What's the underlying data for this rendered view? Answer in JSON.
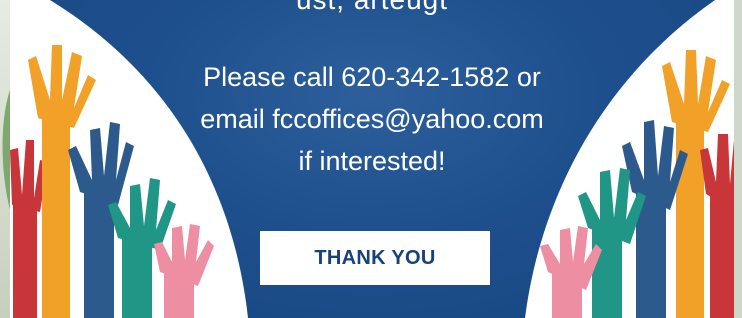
{
  "banner": {
    "cut_off_line": "ust, arteugt",
    "message_lines": [
      "Please call 620-342-1582 or",
      "email fccoffices@yahoo.com",
      "if interested!"
    ],
    "button_label": "THANK YOU"
  },
  "colors": {
    "background_blue": "#1e4f8d",
    "button_text": "#17417a",
    "hand_orange": "#f2a128",
    "hand_blue": "#2c5a8d",
    "hand_teal": "#1f9686",
    "hand_red": "#c9363a",
    "hand_pink": "#ee8ea2"
  },
  "icons": [
    "raised-hand-icon",
    "leaf-icon"
  ]
}
